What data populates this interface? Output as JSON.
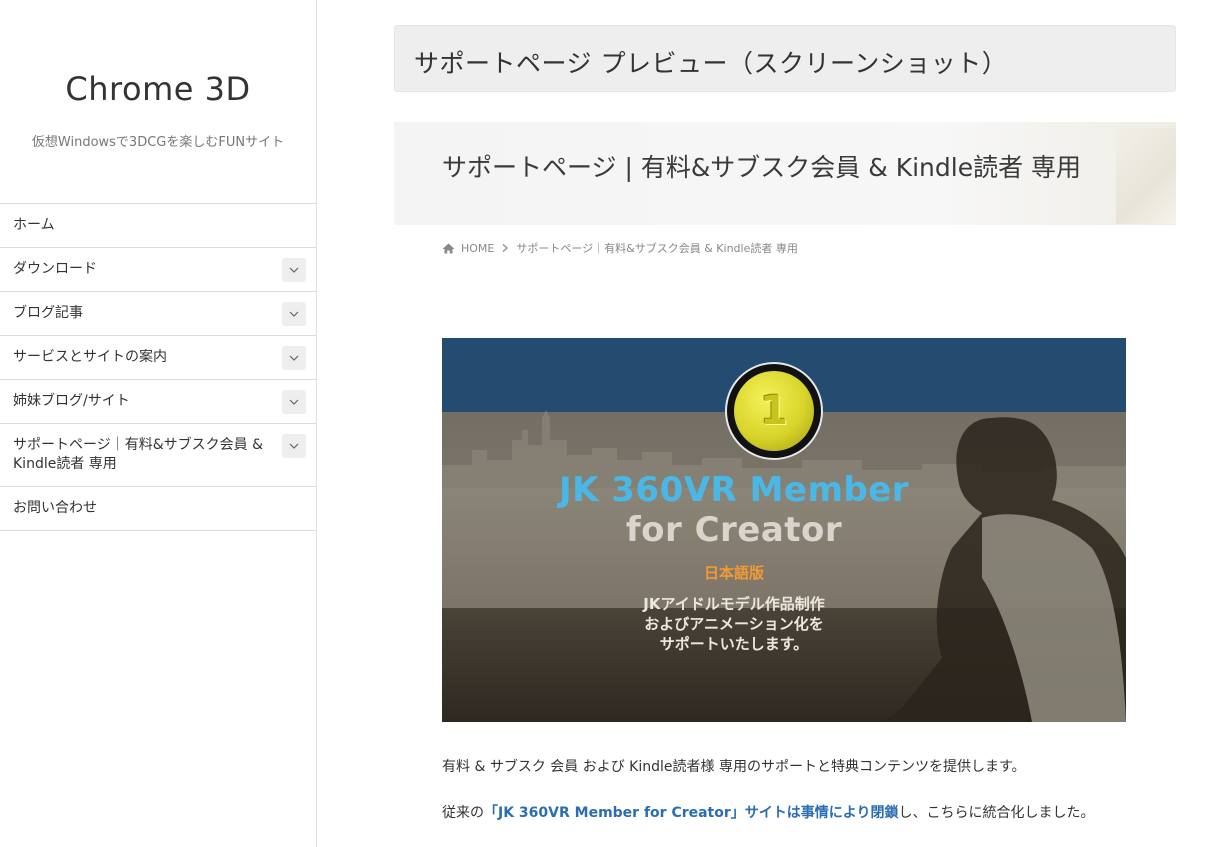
{
  "site": {
    "title": "Chrome 3D",
    "tagline": "仮想Windowsで3DCGを楽しむFUNサイト"
  },
  "nav": {
    "items": [
      {
        "label": "ホーム",
        "has_toggle": false
      },
      {
        "label": "ダウンロード",
        "has_toggle": true
      },
      {
        "label": "ブログ記事",
        "has_toggle": true
      },
      {
        "label": "サービスとサイトの案内",
        "has_toggle": true
      },
      {
        "label": "姉妹ブログ/サイト",
        "has_toggle": true
      },
      {
        "label": "サポートページ｜有料&サブスク会員 & Kindle読者 専用",
        "has_toggle": true
      },
      {
        "label": "お問い合わせ",
        "has_toggle": false
      }
    ]
  },
  "main": {
    "page_title": "サポートページ プレビュー（スクリーンショット）",
    "preview": {
      "banner_title": "サポートページ | 有料&サブスク会員 & Kindle読者 専用",
      "breadcrumb": {
        "home": "HOME",
        "current": "サポートページ｜有料&サブスク会員 & Kindle読者 専用"
      },
      "hero": {
        "coin_number": "1",
        "title_line1": "JK 360VR Member",
        "title_line2": "for Creator",
        "lang": "日本語版",
        "desc_line1": "JKアイドルモデル作品制作",
        "desc_line2": "およびアニメーション化を",
        "desc_line3": "サポートいたします。"
      },
      "intro": "有料 & サブスク 会員 および Kindle読者様 専用のサポートと特典コンテンツを提供します。",
      "note_prefix": "従来の",
      "note_link": "「JK 360VR Member for Creator」サイトは事情により閉鎖",
      "note_suffix": "し、こちらに統合化しました。"
    }
  },
  "colors": {
    "hero_topbar": "#234c70",
    "hero_title": "#4ab8e6",
    "hero_lang": "#f29a36",
    "link": "#2a6db0"
  }
}
